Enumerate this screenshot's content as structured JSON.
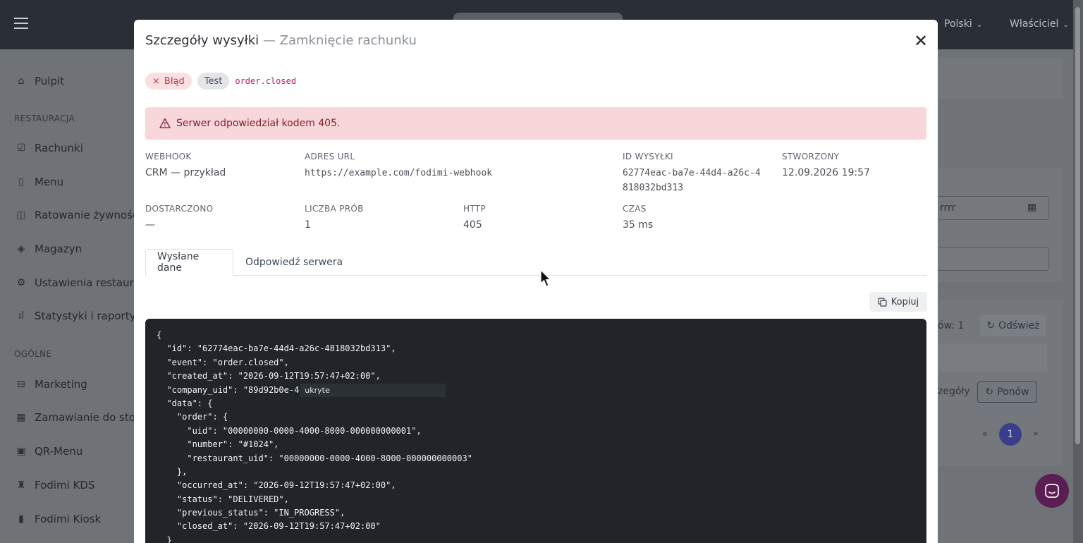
{
  "topbar": {
    "language": "Polski",
    "user": "Właściciel"
  },
  "sidebar": {
    "items": [
      {
        "label": "Pulpit",
        "icon": "home-icon"
      },
      {
        "section": "RESTAURACJA"
      },
      {
        "label": "Rachunki",
        "icon": "check-square-icon"
      },
      {
        "label": "Menu",
        "icon": "book-icon"
      },
      {
        "label": "Ratowanie żywności",
        "icon": "bag-icon"
      },
      {
        "label": "Magazyn",
        "icon": "layers-icon"
      },
      {
        "label": "Ustawienia restaurac",
        "icon": "gear-icon"
      },
      {
        "label": "Statystyki i raporty",
        "icon": "bar-chart-icon"
      },
      {
        "section": "OGÓLNE"
      },
      {
        "label": "Marketing",
        "icon": "inbox-icon"
      },
      {
        "label": "Zamawianie do stolik",
        "icon": "grid-icon"
      },
      {
        "label": "QR-Menu",
        "icon": "qr-icon"
      },
      {
        "label": "Fodimi KDS",
        "icon": "chef-hat-icon"
      },
      {
        "label": "Fodimi Kiosk",
        "icon": "kiosk-icon"
      }
    ]
  },
  "background": {
    "date_placeholder": "rrrr",
    "count_text": "ów: 1",
    "refresh_label": "Odśwież",
    "details_label": "zegóły",
    "retry_label": "Ponów",
    "page_prev": "«",
    "page_current": "1",
    "page_next": "»"
  },
  "modal": {
    "title": "Szczegóły wysyłki",
    "subtitle": "— Zamknięcie rachunku",
    "close_symbol": "✕",
    "badge_error": "Błąd",
    "badge_error_icon": "×",
    "badge_test": "Test",
    "event": "order.closed",
    "alert_text": "Serwer odpowiedział kodem 405.",
    "fields": {
      "webhook_label": "WEBHOOK",
      "webhook_value": "CRM — przykład",
      "url_label": "ADRES URL",
      "url_value": "https://example.com/fodimi-webhook",
      "id_label": "ID WYSYŁKI",
      "id_value": "62774eac-ba7e-44d4-a26c-4818032bd313",
      "created_label": "STWORZONY",
      "created_value": "12.09.2026 19:57",
      "delivered_label": "DOSTARCZONO",
      "delivered_value": "—",
      "attempts_label": "LICZBA PRÓB",
      "attempts_value": "1",
      "http_label": "HTTP",
      "http_value": "405",
      "time_label": "CZAS",
      "time_value": "35 ms"
    },
    "tabs": {
      "sent": "Wysłane dane",
      "response": "Odpowiedź serwera"
    },
    "copy_label": "Kopiuj",
    "hidden_label": "ukryte",
    "code_lines": [
      "{",
      "  \"id\": \"62774eac-ba7e-44d4-a26c-4818032bd313\",",
      "  \"event\": \"order.closed\",",
      "  \"created_at\": \"2026-09-12T19:57:47+02:00\",",
      "  \"company_uid\": \"89d92b0e-4",
      "  \"data\": {",
      "    \"order\": {",
      "      \"uid\": \"00000000-0000-4000-8000-000000000001\",",
      "      \"number\": \"#1024\",",
      "      \"restaurant_uid\": \"00000000-0000-4000-8000-000000000003\"",
      "    },",
      "    \"occurred_at\": \"2026-09-12T19:57:47+02:00\",",
      "    \"status\": \"DELIVERED\",",
      "    \"previous_status\": \"IN_PROGRESS\",",
      "    \"closed_at\": \"2026-09-12T19:57:47+02:00\"",
      "  }"
    ]
  }
}
